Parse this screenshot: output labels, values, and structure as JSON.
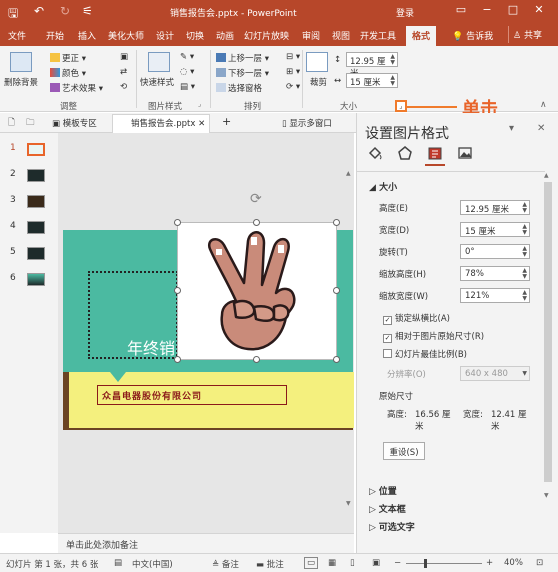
{
  "colors": {
    "accent": "#b7472a",
    "callout": "#e8642a",
    "teal": "#4bbaa1"
  },
  "titlebar": {
    "doc_title": "销售报告会.pptx  -  PowerPoint",
    "login": "登录"
  },
  "tabs": [
    "文件",
    "开始",
    "插入",
    "美化大师",
    "设计",
    "切换",
    "动画",
    "幻灯片放映",
    "审阅",
    "视图",
    "开发工具",
    "格式"
  ],
  "tell_me": "告诉我",
  "share": "共享",
  "ribbon": {
    "remove_bg": "删除背景",
    "corrections": "更正",
    "color": "颜色",
    "artistic": "艺术效果",
    "adjust_label": "调整",
    "quick_styles": "快速样式",
    "picture_styles_label": "图片样式",
    "bring_forward": "上移一层",
    "send_backward": "下移一层",
    "selection_pane": "选择窗格",
    "arrange_label": "排列",
    "crop": "裁剪",
    "height_value": "12.95 厘米",
    "width_value": "15 厘米",
    "size_label": "大小"
  },
  "callout": "单击",
  "doc_tabs": {
    "template_tab": "模板专区",
    "file_tab": "销售报告会.pptx",
    "multi_window": "显示多窗口"
  },
  "slides": [
    1,
    2,
    3,
    4,
    5,
    6
  ],
  "slide": {
    "title_text": "年终销",
    "company": "众昌电器股份有限公司"
  },
  "notes_placeholder": "单击此处添加备注",
  "pane": {
    "title": "设置图片格式",
    "section_size": "大小",
    "height_label": "高度(E)",
    "height_value": "12.95 厘米",
    "width_label": "宽度(D)",
    "width_value": "15 厘米",
    "rotation_label": "旋转(T)",
    "rotation_value": "0°",
    "scale_h_label": "缩放高度(H)",
    "scale_h_value": "78%",
    "scale_w_label": "缩放宽度(W)",
    "scale_w_value": "121%",
    "lock_ratio": "锁定纵横比(A)",
    "relative_original": "相对于图片原始尺寸(R)",
    "best_scale": "幻灯片最佳比例(B)",
    "resolution_label": "分辨率(O)",
    "resolution_value": "640 x 480",
    "original_size": "原始尺寸",
    "orig_height_label": "高度:",
    "orig_height_value": "16.56 厘米",
    "orig_width_label": "宽度:",
    "orig_width_value": "12.41 厘米",
    "reset": "重设(S)",
    "position": "位置",
    "textbox": "文本框",
    "alt_text": "可选文字"
  },
  "status": {
    "slide_info": "幻灯片 第 1 张，共 6 张",
    "language": "中文(中国)",
    "notes": "备注",
    "comments": "批注",
    "zoom": "40%"
  }
}
